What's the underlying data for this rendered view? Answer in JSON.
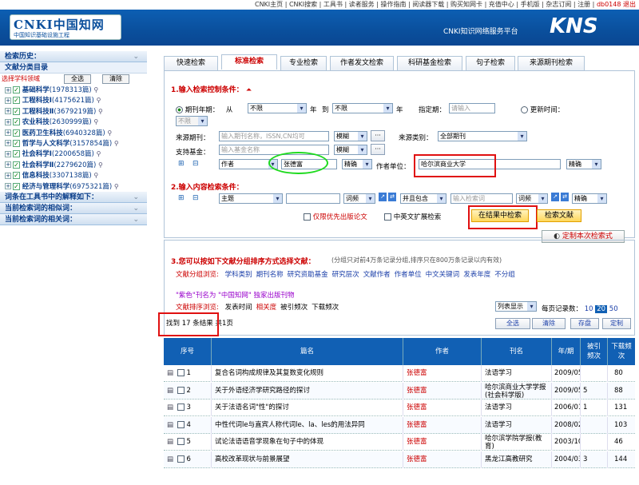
{
  "topnav": {
    "links": "CNKI主页 | CNKI搜索 | 工具书 | 读者服务 | 操作指南 | 阅读器下载 | 购买知网卡 | 充值中心 | 手机版 | 杂志订阅 | 注册 |",
    "user": "db0148 退出"
  },
  "banner": {
    "logo_main": "CNKI中国知网",
    "logo_sub": "中国知识基础设施工程",
    "platform": "CNKI知识网络服务平台",
    "kns": "KNS"
  },
  "sidebar": {
    "history": "检索历史：",
    "catalog": "文献分类目录",
    "subject_label": "选择学科领域",
    "select_all": "全选",
    "clear": "清除",
    "subjects": [
      {
        "name": "基础科学",
        "count": "(1978313篇)"
      },
      {
        "name": "工程科技Ⅰ",
        "count": "(4175621篇)"
      },
      {
        "name": "工程科技Ⅱ",
        "count": "(3679219篇)"
      },
      {
        "name": "农业科技",
        "count": "(2630999篇)"
      },
      {
        "name": "医药卫生科技",
        "count": "(6940328篇)"
      },
      {
        "name": "哲学与人文科学",
        "count": "(3157854篇)"
      },
      {
        "name": "社会科学Ⅰ",
        "count": "(2200658篇)"
      },
      {
        "name": "社会科学Ⅱ",
        "count": "(2279620篇)"
      },
      {
        "name": "信息科技",
        "count": "(3307138篇)"
      },
      {
        "name": "经济与管理科学",
        "count": "(6975321篇)"
      }
    ],
    "toolbook": "词条在工具书中的解释如下：",
    "similar": "当前检索词的相似词：",
    "related": "当前检索词的相关词："
  },
  "tabs": [
    "快速检索",
    "标准检索",
    "专业检索",
    "作者发文检索",
    "科研基金检索",
    "句子检索",
    "来源期刊检索"
  ],
  "form": {
    "sec1_title": "1.输入检索控制条件：",
    "period_label": "期刊年期：",
    "from": "从",
    "from_val": "不限",
    "year": "年",
    "to": "到",
    "to_val": "不限",
    "year2": "年",
    "specified": "指定期：",
    "specified_ph": "请输入",
    "update_time": "更新时间：",
    "update_val": "不限",
    "source_label": "来源期刊：",
    "source_ph": "输入期刊名称，ISSN,CN均可",
    "fuzzy": "模糊",
    "dots": "···",
    "source_cat_label": "来源类别：",
    "source_cat_val": "全部期刊",
    "fund_label": "支持基金：",
    "fund_ph": "输入基金名称",
    "fuzzy2": "模糊",
    "dots2": "···",
    "author_field": "作者",
    "author_val": "张德富",
    "exact": "精确",
    "unit_label": "作者单位：",
    "unit_val": "哈尔滨商业大学",
    "exact2": "精确",
    "sec2_title": "2.输入内容检索条件：",
    "topic_field": "主题",
    "freq": "词频",
    "combine": "并且包含",
    "kw_ph": "输入检索词",
    "freq2": "词频",
    "exact3": "精确",
    "online_first": "仅限优先出版论文",
    "cn_en": "中英文扩展检索",
    "search_in_results": "在结果中检索",
    "search": "检索文献",
    "custom": "定制本次检索式"
  },
  "group": {
    "title": "3.您可以按如下文献分组排序方式选择文献：",
    "note": "(分组只对前4万条记录分组,排序只在800万条记录以内有效)",
    "browse_label": "文献分组浏览:",
    "browse_items": [
      "学科类别",
      "期刊名称",
      "研究资助基金",
      "研究层次",
      "文献作者",
      "作者单位",
      "中文关键词",
      "发表年度",
      "不分组"
    ],
    "purple_note": "\"紫色\"刊名为 \"中国知网\" 独家出版刊物",
    "sort_label": "文献排序浏览:",
    "sort_items": [
      "发表时间",
      "相关度",
      "被引频次",
      "下载频次"
    ],
    "list_display": "列表显示",
    "per_page_label": "每页记录数：",
    "per_page": [
      "10",
      "20",
      "50"
    ],
    "result_count": "找到 17 条结果",
    "pages": "共1页",
    "select_all": "全选",
    "clear": "清除",
    "save": "存盘",
    "custom": "定制"
  },
  "table": {
    "headers": [
      "序号",
      "篇名",
      "作者",
      "刊名",
      "年/期",
      "被引频次",
      "下载频次"
    ],
    "rows": [
      {
        "n": "1",
        "title": "复合名词构成规律及其复数变化规则",
        "author": "张德富",
        "source": "法语学习",
        "date": "2009/05",
        "cite": "",
        "dl": "80"
      },
      {
        "n": "2",
        "title": "关于外语经济学研究路径的探讨",
        "author": "张德富",
        "source": "哈尔滨商业大学学报(社会科学版)",
        "date": "2009/05",
        "cite": "5",
        "dl": "88"
      },
      {
        "n": "3",
        "title": "关于法语名词\"性\"的探讨",
        "author": "张德富",
        "source": "法语学习",
        "date": "2006/01",
        "cite": "1",
        "dl": "131"
      },
      {
        "n": "4",
        "title": "中性代词le与直宾人称代词le、la、les的用法异同",
        "author": "张德富",
        "source": "法语学习",
        "date": "2008/02",
        "cite": "",
        "dl": "103"
      },
      {
        "n": "5",
        "title": "试论法语语音学现象在句子中的体现",
        "author": "张德富",
        "source": "哈尔滨学院学报(教育)",
        "date": "2003/10",
        "cite": "",
        "dl": "46"
      },
      {
        "n": "6",
        "title": "高校改革现状与前景展望",
        "author": "张德富",
        "source": "黑龙江高教研究",
        "date": "2004/03",
        "cite": "3",
        "dl": "144"
      }
    ]
  }
}
